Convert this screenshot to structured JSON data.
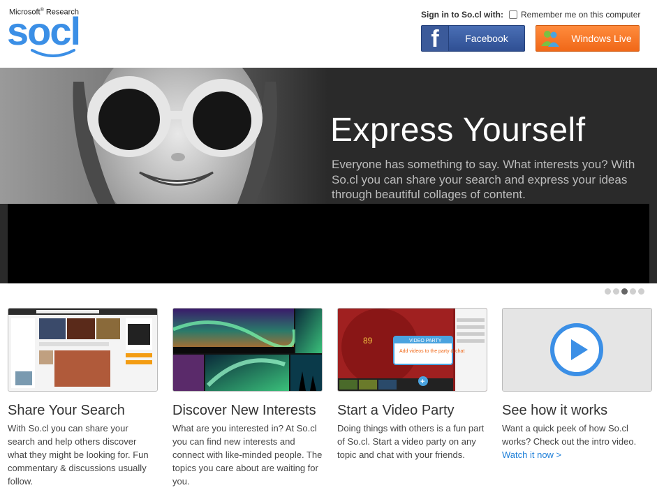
{
  "header": {
    "brand_small": "Microsoft",
    "brand_small_suffix": "Research",
    "logo_text": "socl",
    "signin_label": "Sign in to So.cl with:",
    "remember_label": "Remember me on this computer",
    "facebook_label": "Facebook",
    "windows_live_label": "Windows Live"
  },
  "hero": {
    "title": "Express Yourself",
    "text": "Everyone has something to say. What interests you? With So.cl you can share your search and express your ideas through beautiful collages of content."
  },
  "carousel": {
    "count": 5,
    "active": 2
  },
  "cards": [
    {
      "title": "Share Your Search",
      "text": "With So.cl you can share your search and help others discover what they might be looking for. Fun commentary & discussions usually follow."
    },
    {
      "title": "Discover New Interests",
      "text": "What are you interested in? At So.cl you can find new interests and connect with like-minded people. The topics you care about are waiting for you."
    },
    {
      "title": "Start a Video Party",
      "text": "Doing things with others is a fun part of So.cl. Start a video party on any topic and chat with your friends.",
      "bubble_title": "VIDEO PARTY",
      "bubble_text": "Add videos to the party & chat"
    },
    {
      "title": "See how it works",
      "text": "Want a quick peek of how So.cl works? Check out the intro video.",
      "link": "Watch it now >"
    }
  ],
  "colors": {
    "accent": "#1e7fd8",
    "facebook": "#3b5998",
    "windows_live": "#f06818",
    "logo": "#3b8fe6"
  }
}
